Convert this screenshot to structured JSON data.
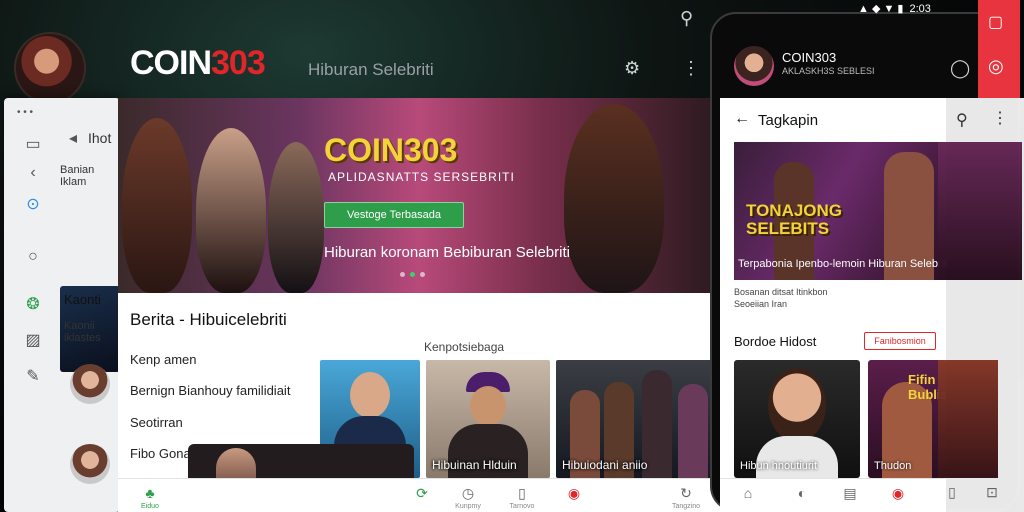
{
  "header": {
    "logo_main": "COIN",
    "logo_num": "303",
    "tagline": "Hiburan Selebriti"
  },
  "left_panel": {
    "title": "Ihot",
    "item1": "Banian Iklam",
    "item2": "Kaonti",
    "item3": "Kaonii iklastes"
  },
  "hero": {
    "title": "COIN303",
    "subtitle": "APLIDASNATTS SERSEBRITI",
    "button": "Vestoge Terbasada",
    "caption": "Hiburan koronam Bebiburan Selebriti"
  },
  "main": {
    "section_title": "Berita - Hibuicelebriti",
    "side1": "Kenp amen",
    "side2": "Bernign   Bianhouy familidiait",
    "side3": "Seotirran",
    "side4": "Fibo Gonar",
    "trending_label": "Kenpotsiebaga",
    "card2_caption": "Hibuinan Hlduin",
    "card3_caption": "Hibuiodani aniio"
  },
  "bottom_nav": {
    "item1": "Eiduo",
    "item2": "Kunpmy",
    "item3": "Tarnovo",
    "item4": "Tangzino"
  },
  "phone": {
    "status": "2:03",
    "contact_name": "COIN303",
    "contact_sub": "AKLASKH3S SEBLESI",
    "topbar_title": "Tagkapin",
    "featured_title": "TONAJONG SELEBITS",
    "featured_caption": "Terpabonia Ipenbo-lemoin Hiburan Selebriti",
    "featured_sub": "Bosanan ditsat Itinkbon\nSeoeiian Iran",
    "section": "Bordoe Hidost",
    "badge": "Fanibosmion",
    "card1_caption": "Hibun hnoutiurit",
    "card2_caption": "Thudon",
    "card2_title": "Fifin Bublis"
  },
  "colors": {
    "brand_red": "#e0262b",
    "accent_green": "#2e9e4a",
    "hero_yellow": "#f4d23a"
  }
}
